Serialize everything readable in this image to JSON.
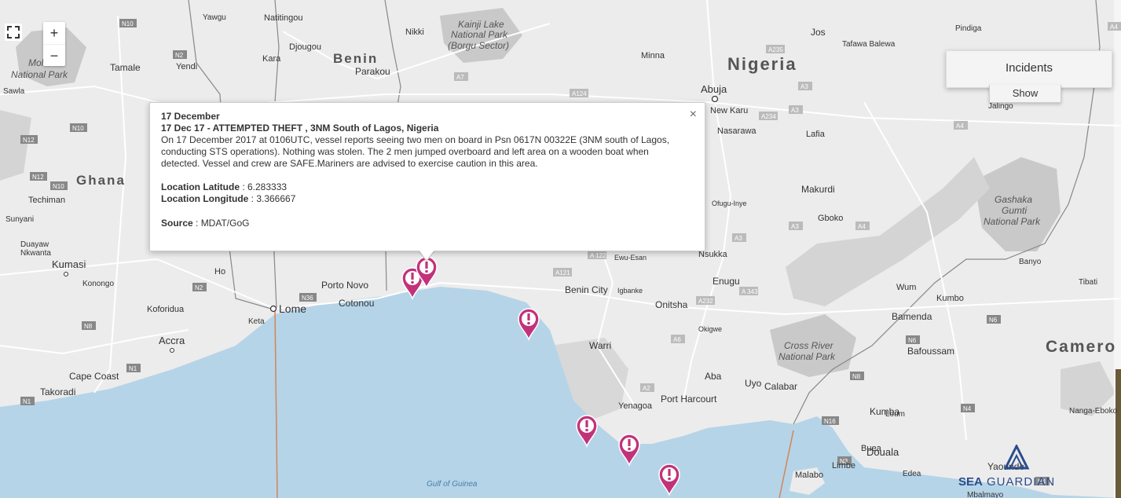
{
  "map": {
    "countries": [
      "Nigeria",
      "Benin",
      "Ghana",
      "Camero"
    ],
    "cities": [
      {
        "name": "Lome",
        "capital": true
      },
      {
        "name": "Accra"
      },
      {
        "name": "Abuja",
        "capital": true
      },
      {
        "name": "Kumasi"
      },
      {
        "name": "Takoradi"
      },
      {
        "name": "Cape Coast"
      },
      {
        "name": "Koforidua"
      },
      {
        "name": "Tamale"
      },
      {
        "name": "Yendi"
      },
      {
        "name": "Sawla"
      },
      {
        "name": "Techiman"
      },
      {
        "name": "Sunyani"
      },
      {
        "name": "Duayaw Nkwanta"
      },
      {
        "name": "Konongo"
      },
      {
        "name": "Keta"
      },
      {
        "name": "Ho"
      },
      {
        "name": "Porto Novo"
      },
      {
        "name": "Cotonou"
      },
      {
        "name": "Parakou"
      },
      {
        "name": "Djougou"
      },
      {
        "name": "Kara"
      },
      {
        "name": "Natitingou"
      },
      {
        "name": "Yawgu"
      },
      {
        "name": "Nikki"
      },
      {
        "name": "Minna"
      },
      {
        "name": "New Karu"
      },
      {
        "name": "Nasarawa"
      },
      {
        "name": "Lafia"
      },
      {
        "name": "Makurdi"
      },
      {
        "name": "Ofugu-Inye"
      },
      {
        "name": "Gboko"
      },
      {
        "name": "Nsukka"
      },
      {
        "name": "Enugu"
      },
      {
        "name": "Ewu-Esan"
      },
      {
        "name": "Benin City"
      },
      {
        "name": "Igbanke"
      },
      {
        "name": "Onitsha"
      },
      {
        "name": "Okigwe"
      },
      {
        "name": "Warri"
      },
      {
        "name": "Aba"
      },
      {
        "name": "Uyo"
      },
      {
        "name": "Calabar"
      },
      {
        "name": "Yenagoa"
      },
      {
        "name": "Port Harcourt"
      },
      {
        "name": "Bamenda"
      },
      {
        "name": "Bafoussam"
      },
      {
        "name": "Kumba"
      },
      {
        "name": "Loum"
      },
      {
        "name": "Buea"
      },
      {
        "name": "Douala"
      },
      {
        "name": "Limbe"
      },
      {
        "name": "Malabo"
      },
      {
        "name": "Edea"
      },
      {
        "name": "Yaounde"
      },
      {
        "name": "Mbalmayo"
      },
      {
        "name": "Nanga-Eboko"
      },
      {
        "name": "Wum"
      },
      {
        "name": "Kumbo"
      },
      {
        "name": "Tibati"
      },
      {
        "name": "Banyo"
      },
      {
        "name": "Jalingo"
      },
      {
        "name": "Jos"
      },
      {
        "name": "Pindiga"
      },
      {
        "name": "Tafawa Balewa"
      },
      {
        "name": "Gashaka Gumti National Park"
      },
      {
        "name": "Cross River National Park"
      },
      {
        "name": "Kainji Lake National Park (Borgu Sector)"
      },
      {
        "name": "Mole National Park"
      },
      {
        "name": "Gulf of Guinea"
      }
    ],
    "road_shields": [
      "N10",
      "N2",
      "N12",
      "N10",
      "N12",
      "N10",
      "N2",
      "N36",
      "N8",
      "N1",
      "N1",
      "A7",
      "A124",
      "A124",
      "A235",
      "A3",
      "A234",
      "A3",
      "A4",
      "A4",
      "A3",
      "A3",
      "A122",
      "A121",
      "A232",
      "A343",
      "A6",
      "A2",
      "A2",
      "N6",
      "N6",
      "N8",
      "N16",
      "N3",
      "N4",
      "N4"
    ],
    "incident_marker_color": "#c2327a",
    "sea_color": "#b5d4e8",
    "land_color": "#ececec",
    "park_color": "#c9c9c9"
  },
  "controls": {
    "zoom_in": "+",
    "zoom_out": "−"
  },
  "incidents_panel": {
    "title": "Incidents",
    "show_label": "Show"
  },
  "popup": {
    "date": "17 December",
    "headline": "17 Dec 17 - ATTEMPTED THEFT , 3NM South of Lagos, Nigeria",
    "description": "On 17 December 2017 at 0106UTC, vessel reports seeing two men on board in Psn 0617N 00322E (3NM south of Lagos, conducting STS operations). Nothing was stolen. The 2 men jumped overboard and left area on a wooden boat when detected. Vessel and crew are SAFE.Mariners are advised to exercise caution in this area.",
    "lat_label": "Location Latitude",
    "lat_value": " : 6.283333",
    "lon_label": "Location Longitude",
    "lon_value": " : 3.366667",
    "source_label": "Source",
    "source_value": " : MDAT/GoG",
    "close": "×"
  },
  "brand": {
    "text_a": "SEA",
    "text_b": "GUARDIAN",
    "color": "#2b4c8c"
  }
}
